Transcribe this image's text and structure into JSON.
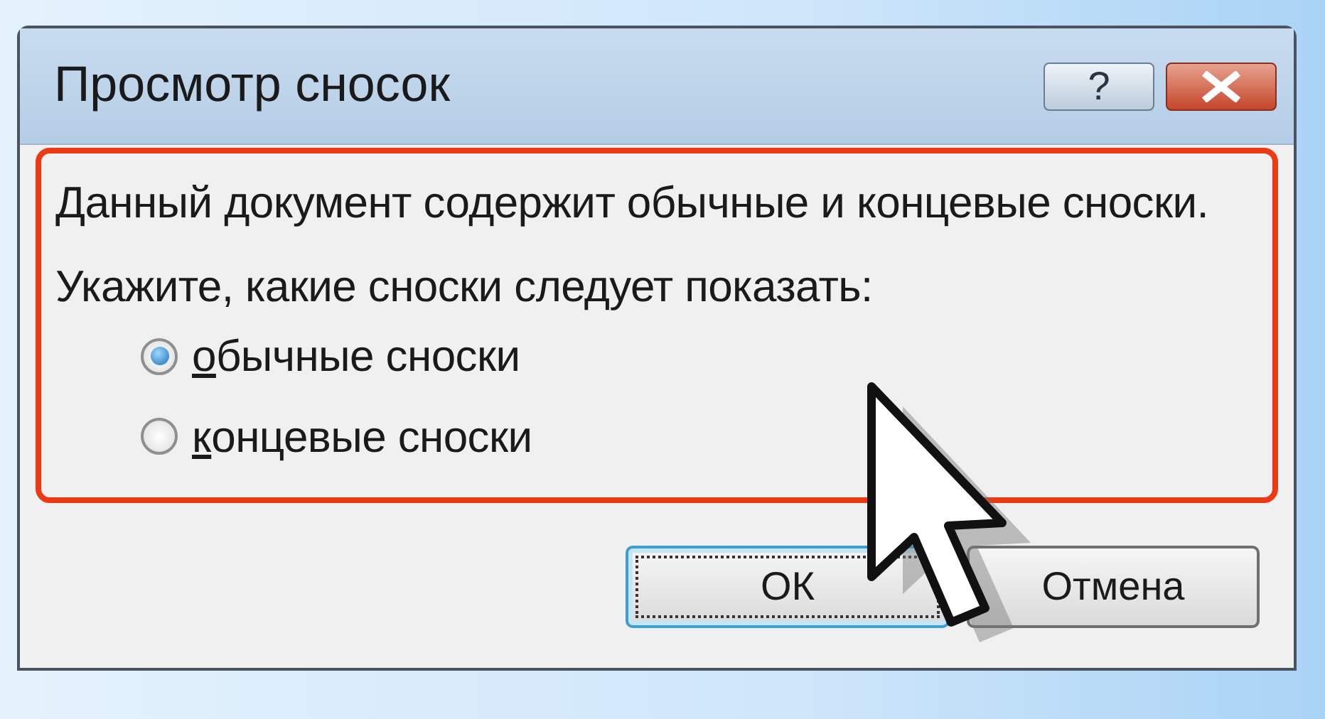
{
  "window": {
    "title": "Просмотр сносок",
    "help_button": "?"
  },
  "content": {
    "highlighted": true,
    "message": "Данный документ содержит обычные и концевые сноски.",
    "prompt": "Укажите, какие сноски следует показать:",
    "options": [
      {
        "label": "обычные сноски",
        "selected": true,
        "mnemonic": true
      },
      {
        "label": "концевые сноски",
        "selected": false,
        "mnemonic": true
      }
    ]
  },
  "buttons": [
    {
      "label": "ОК",
      "default": true
    },
    {
      "label": "Отмена",
      "default": false
    }
  ]
}
